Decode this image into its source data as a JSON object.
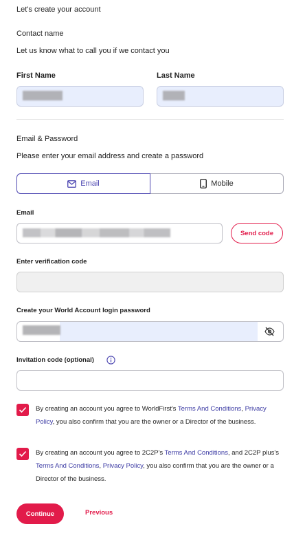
{
  "page": {
    "heading": "Let's create your account",
    "contact_section_title": "Contact name",
    "contact_section_desc": "Let us know what to call you if we contact you",
    "email_section_title": "Email & Password",
    "email_section_desc": "Please enter your email address and create a password"
  },
  "fields": {
    "first_name_label": "First Name",
    "last_name_label": "Last Name",
    "email_label": "Email",
    "verification_label": "Enter verification code",
    "password_label": "Create your World Account login password",
    "invitation_label": "Invitation code (optional)"
  },
  "tabs": {
    "email": "Email",
    "mobile": "Mobile"
  },
  "buttons": {
    "send_code": "Send code",
    "continue": "Continue",
    "previous": "Previous"
  },
  "consent_1": {
    "pre": "By creating an account you agree to WorldFirst's ",
    "link_terms": "Terms And Conditions",
    "comma": ", ",
    "link_privacy": "Privacy Policy",
    "post": ", you also confirm that you are the owner or a Director of the business.",
    "checked": true
  },
  "consent_2": {
    "pre": "By creating an account you agree to 2C2P's ",
    "link_terms": "Terms And Conditions",
    "mid": ", and 2C2P plus's ",
    "link_terms_2": "Terms And Conditions",
    "comma": ", ",
    "link_privacy": "Privacy Policy",
    "post": ", you also confirm that you are the owner or a Director of the business.",
    "checked": true
  },
  "colors": {
    "brand_red": "#e21b4a",
    "accent_indigo": "#4a44b0",
    "autofill_bg": "#e8eefd"
  },
  "icons": {
    "email_tab": "envelope-icon",
    "mobile_tab": "phone-icon",
    "password_toggle": "eye-slash-icon",
    "invitation_info": "info-icon",
    "checkbox": "check-icon"
  }
}
